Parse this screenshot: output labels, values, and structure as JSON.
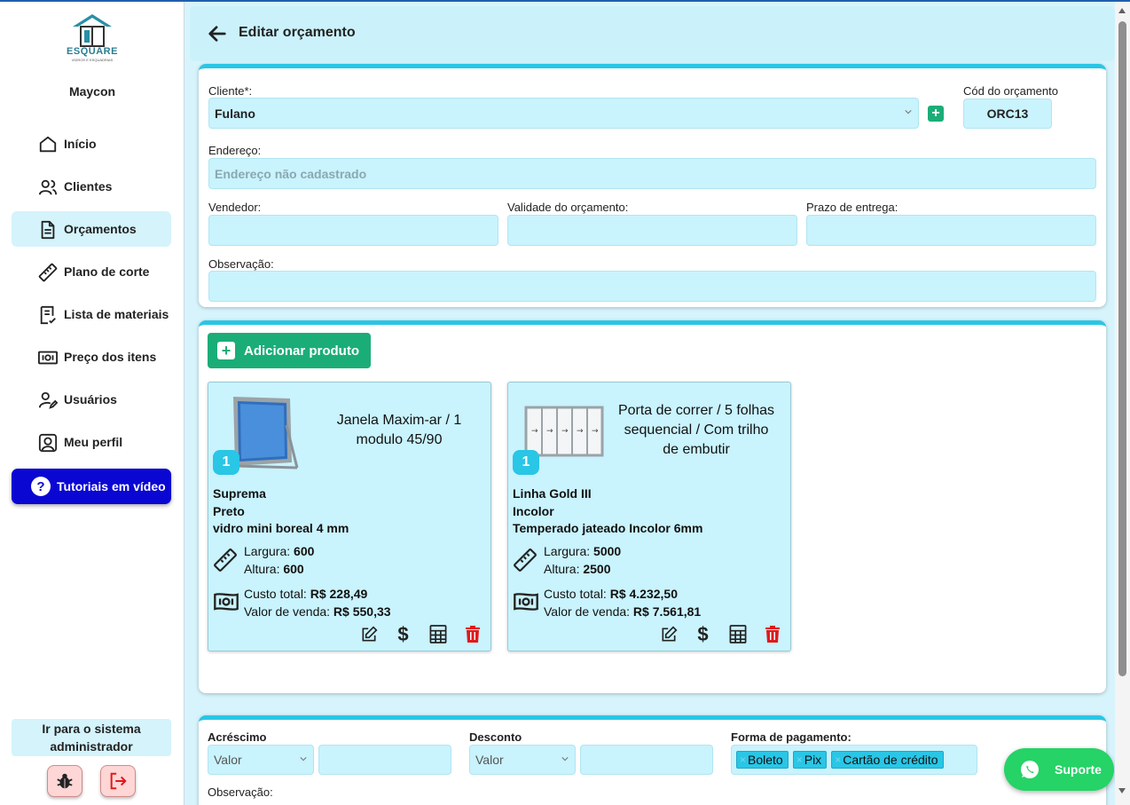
{
  "sidebar": {
    "logo_text": "ESQUARE",
    "logo_subtext": "VIDROS E ESQUADRIAS",
    "username": "Maycon",
    "items": [
      {
        "label": "Início",
        "icon": "home-icon"
      },
      {
        "label": "Clientes",
        "icon": "users-icon"
      },
      {
        "label": "Orçamentos",
        "icon": "document-icon",
        "active": true
      },
      {
        "label": "Plano de corte",
        "icon": "ruler-icon"
      },
      {
        "label": "Lista de materiais",
        "icon": "checklist-icon"
      },
      {
        "label": "Preço dos itens",
        "icon": "money-icon"
      },
      {
        "label": "Usuários",
        "icon": "user-edit-icon"
      },
      {
        "label": "Meu perfil",
        "icon": "profile-icon"
      }
    ],
    "tutorial_label": "Tutoriais em vídeo",
    "admin_line1": "Ir para o sistema",
    "admin_line2": "administrador"
  },
  "header": {
    "title": "Editar orçamento"
  },
  "form": {
    "client_label": "Cliente*:",
    "client_value": "Fulano",
    "code_label": "Cód do orçamento",
    "code_value": "ORC13",
    "address_label": "Endereço:",
    "address_placeholder": "Endereço não cadastrado",
    "seller_label": "Vendedor:",
    "validity_label": "Validade do orçamento:",
    "delivery_label": "Prazo de entrega:",
    "observation_label": "Observação:"
  },
  "products_section": {
    "add_label": "Adicionar produto",
    "products": [
      {
        "title_line1": "Janela Maxim-ar / 1",
        "title_line2": "modulo 45/90",
        "title_line3": "",
        "qty": "1",
        "line": "Suprema",
        "color": "Preto",
        "glass": "vidro mini boreal 4 mm",
        "width_label": "Largura:",
        "width": "600",
        "height_label": "Altura:",
        "height": "600",
        "cost_label": "Custo total:",
        "cost": "R$ 228,49",
        "sale_label": "Valor de venda:",
        "sale": "R$ 550,33"
      },
      {
        "title_line1": "Porta de correr / 5 folhas",
        "title_line2": "sequencial  / Com trilho",
        "title_line3": "de embutir",
        "qty": "1",
        "line": "Linha Gold III",
        "color": "Incolor",
        "glass": "Temperado jateado Incolor 6mm",
        "width_label": "Largura:",
        "width": "5000",
        "height_label": "Altura:",
        "height": "2500",
        "cost_label": "Custo total:",
        "cost": "R$ 4.232,50",
        "sale_label": "Valor de venda:",
        "sale": "R$ 7.561,81"
      }
    ]
  },
  "payment": {
    "surcharge_label": "Acréscimo",
    "surcharge_type": "Valor",
    "discount_label": "Desconto",
    "discount_type": "Valor",
    "method_label": "Forma de pagamento:",
    "methods": [
      "Boleto",
      "Pix",
      "Cartão de crédito"
    ],
    "observation_label": "Observação:"
  },
  "support_label": "Suporte",
  "colors": {
    "accent": "#29c6e6",
    "green": "#1bad78",
    "tutorial": "#0a07d3",
    "field_bg": "#c9f3fd",
    "delete": "#e0191b"
  }
}
